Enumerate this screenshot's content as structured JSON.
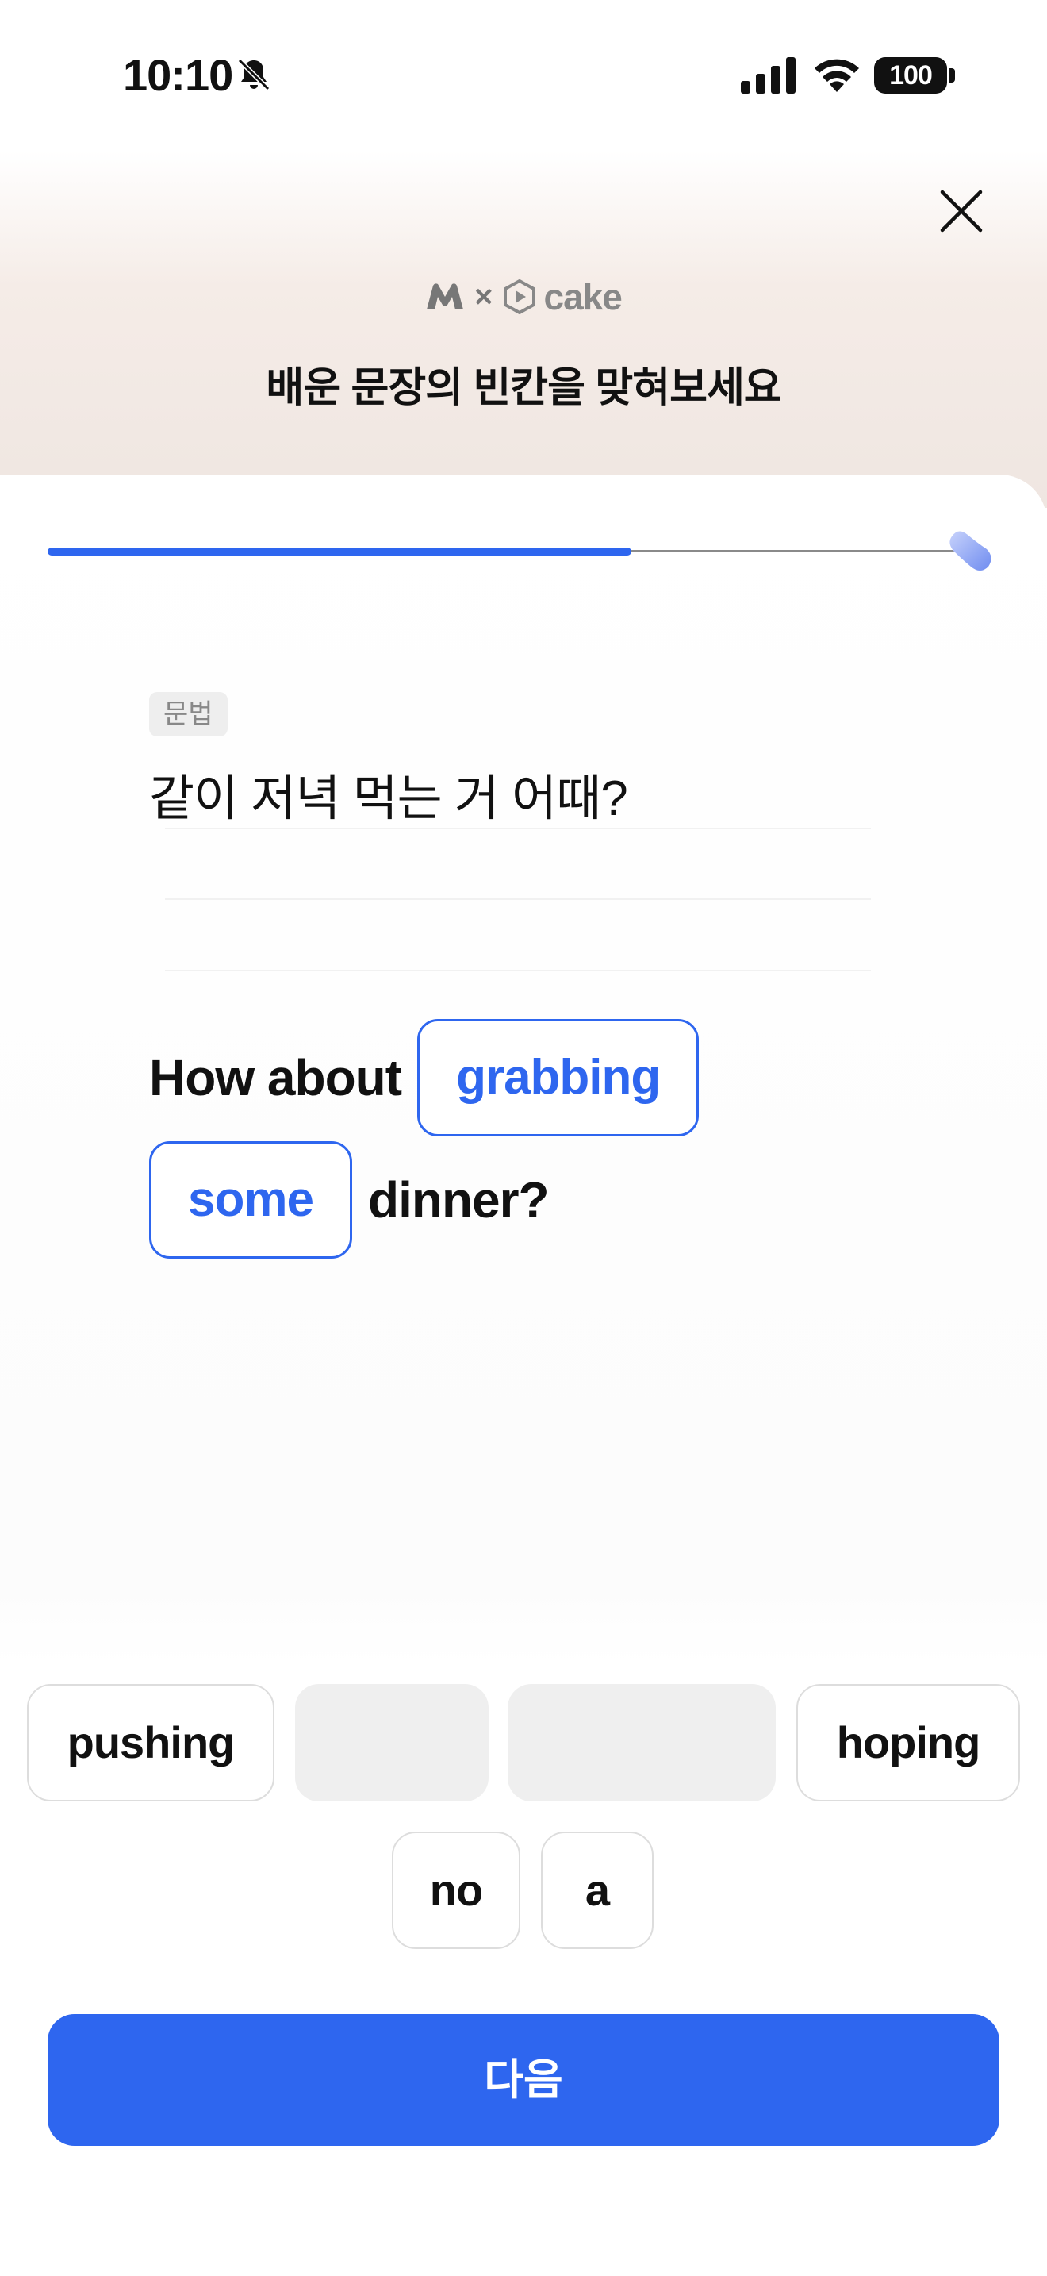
{
  "status_bar": {
    "time": "10:10",
    "battery": "100",
    "icons": [
      "bell-slash-icon",
      "cellular-signal-icon",
      "wifi-icon",
      "battery-icon"
    ]
  },
  "header": {
    "logo_separator": "×",
    "logo_text": "cake",
    "title": "배운 문장의 빈칸을 맞혀보세요",
    "close_icon": "close-icon"
  },
  "progress": {
    "fraction": 0.64,
    "accent_color": "#2e66ef"
  },
  "question": {
    "tag": "문법",
    "prompt": "같이 저녁 먹는 거 어때?",
    "sentence": {
      "word_1": "How about",
      "slot_1": "grabbing",
      "slot_2": "some",
      "word_2": "dinner?"
    }
  },
  "word_bank": {
    "chips": [
      {
        "label": "pushing",
        "used": false
      },
      {
        "label": "",
        "used": true
      },
      {
        "label": "",
        "used": true
      },
      {
        "label": "hoping",
        "used": false
      },
      {
        "label": "no",
        "used": false
      },
      {
        "label": "a",
        "used": false
      }
    ]
  },
  "next_button": {
    "label": "다음",
    "color": "#2e66ef"
  }
}
